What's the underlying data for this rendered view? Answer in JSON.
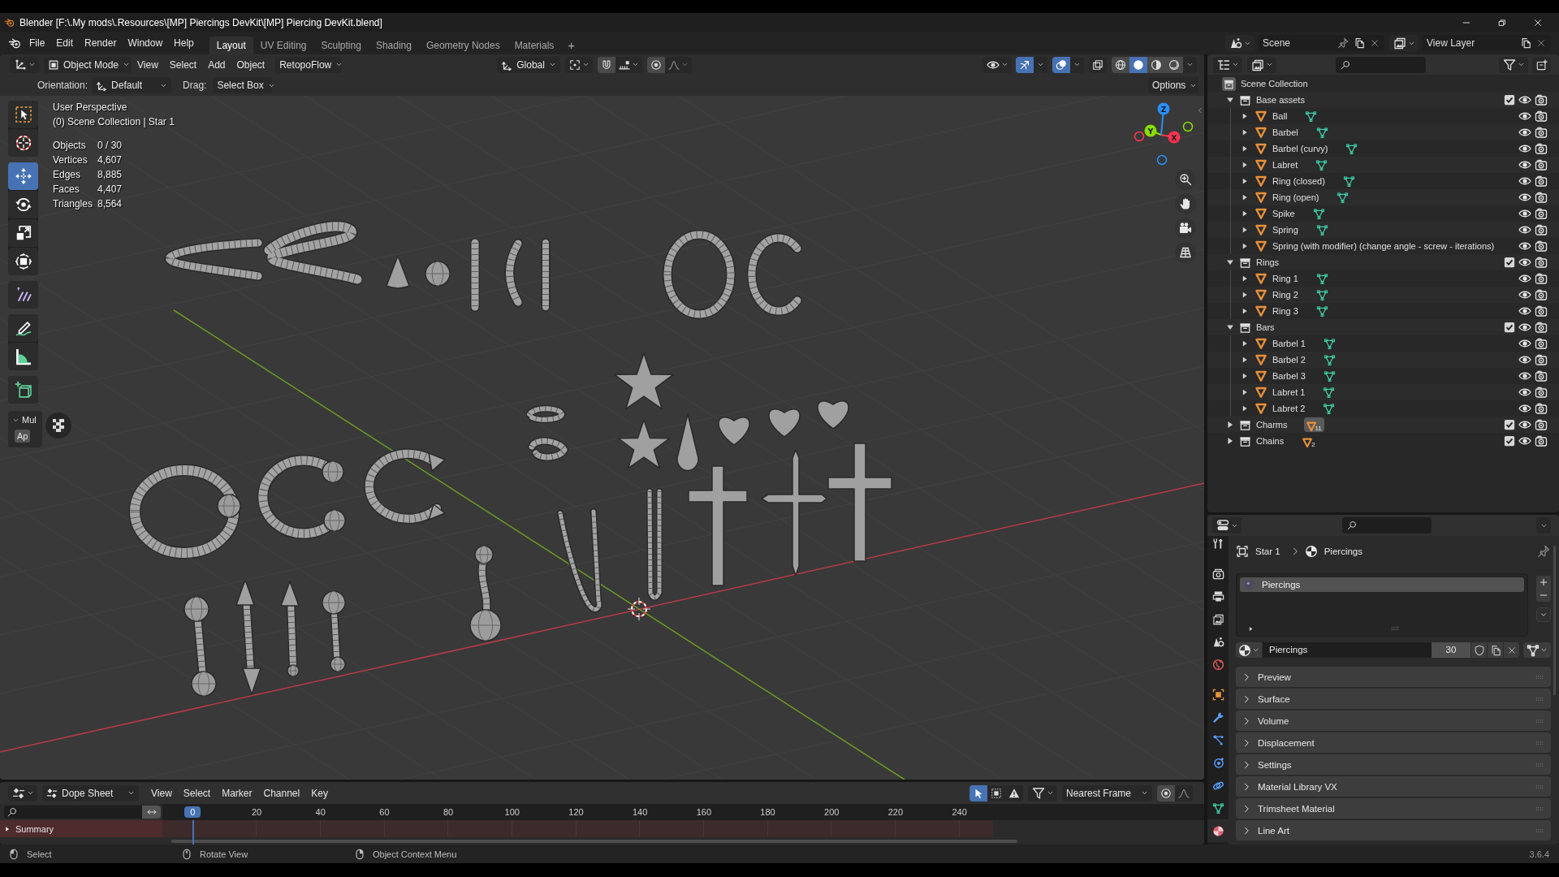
{
  "window": {
    "title": "Blender [F:\\.My mods\\.Resources\\[MP] Piercings DevKit\\[MP] Piercing DevKit.blend]"
  },
  "menus": [
    "File",
    "Edit",
    "Render",
    "Window",
    "Help"
  ],
  "workspaces": [
    {
      "label": "Layout",
      "selected": true
    },
    {
      "label": "UV Editing",
      "selected": false
    },
    {
      "label": "Sculpting",
      "selected": false
    },
    {
      "label": "Shading",
      "selected": false
    },
    {
      "label": "Geometry Nodes",
      "selected": false
    },
    {
      "label": "Materials",
      "selected": false
    }
  ],
  "add_workspace": "+",
  "scene": "Scene",
  "view_layer": "View Layer",
  "viewport": {
    "mode": "Object Mode",
    "menus": [
      "View",
      "Select",
      "Add",
      "Object"
    ],
    "addon_menu": "RetopoFlow",
    "orientation": "Global",
    "gizmos_on": true,
    "overlays_on": true,
    "shading": [
      {
        "kind": "wireframe",
        "selected": false
      },
      {
        "kind": "solid",
        "selected": true
      },
      {
        "kind": "material",
        "selected": false
      },
      {
        "kind": "rendered",
        "selected": false
      }
    ],
    "tool_settings": {
      "orientation_label": "Orientation:",
      "orientation": "Default",
      "drag_label": "Drag:",
      "drag": "Select Box",
      "options": "Options"
    },
    "tools": [
      [
        {
          "kind": "select_box",
          "selected": false
        },
        {
          "kind": "cursor",
          "selected": false
        }
      ],
      [
        {
          "kind": "move",
          "selected": true
        },
        {
          "kind": "rotate",
          "selected": false
        },
        {
          "kind": "scale",
          "selected": false
        },
        {
          "kind": "transform",
          "selected": false
        }
      ],
      [
        {
          "kind": "annotate",
          "selected": false
        }
      ],
      [
        {
          "kind": "draw",
          "selected": false
        },
        {
          "kind": "measure",
          "selected": false
        }
      ],
      [
        {
          "kind": "add_cube",
          "selected": false
        }
      ]
    ],
    "operator_panel": {
      "title": "Mul",
      "button": "Ap",
      "expanded": true
    },
    "info": [
      "User Perspective",
      "(0) Scene Collection | Star 1"
    ],
    "statistics": [
      {
        "label": "Objects",
        "value": "0 / 30"
      },
      {
        "label": "Vertices",
        "value": "4,607"
      },
      {
        "label": "Edges",
        "value": "8,885"
      },
      {
        "label": "Faces",
        "value": "4,407"
      },
      {
        "label": "Triangles",
        "value": "8,564"
      }
    ],
    "gizmo_axes": [
      {
        "label": "X",
        "color": "#ff3352"
      },
      {
        "label": "Y",
        "color": "#8bdc00"
      },
      {
        "label": "Z",
        "color": "#2890ff"
      }
    ]
  },
  "outliner": {
    "root": "Scene Collection",
    "collections": [
      {
        "name": "Base assets",
        "expanded": true,
        "checked": true,
        "visible": true,
        "renderable": true,
        "children": [
          {
            "name": "Ball",
            "expanded": false,
            "data_icon": true,
            "visible": true,
            "renderable": true
          },
          {
            "name": "Barbel",
            "expanded": false,
            "data_icon": true,
            "visible": true,
            "renderable": true
          },
          {
            "name": "Barbel (curvy)",
            "expanded": false,
            "data_icon": true,
            "visible": true,
            "renderable": true
          },
          {
            "name": "Labret",
            "expanded": false,
            "data_icon": true,
            "visible": true,
            "renderable": true
          },
          {
            "name": "Ring (closed)",
            "expanded": false,
            "data_icon": true,
            "visible": true,
            "renderable": true
          },
          {
            "name": "Ring (open)",
            "expanded": false,
            "data_icon": true,
            "visible": true,
            "renderable": true
          },
          {
            "name": "Spike",
            "expanded": false,
            "data_icon": true,
            "visible": true,
            "renderable": true
          },
          {
            "name": "Spring",
            "expanded": false,
            "data_icon": true,
            "visible": true,
            "renderable": true
          },
          {
            "name": "Spring (with modifier) (change angle - screw - iterations)",
            "expanded": false,
            "data_icon": false,
            "visible": true,
            "renderable": true
          }
        ]
      },
      {
        "name": "Rings",
        "expanded": true,
        "checked": true,
        "visible": true,
        "renderable": true,
        "children": [
          {
            "name": "Ring 1",
            "expanded": false,
            "data_icon": true,
            "visible": true,
            "renderable": true
          },
          {
            "name": "Ring 2",
            "expanded": false,
            "data_icon": true,
            "visible": true,
            "renderable": true
          },
          {
            "name": "Ring 3",
            "expanded": false,
            "data_icon": true,
            "visible": true,
            "renderable": true
          }
        ]
      },
      {
        "name": "Bars",
        "expanded": true,
        "checked": true,
        "visible": true,
        "renderable": true,
        "children": [
          {
            "name": "Barbel 1",
            "expanded": false,
            "data_icon": true,
            "visible": true,
            "renderable": true
          },
          {
            "name": "Barbel 2",
            "expanded": false,
            "data_icon": true,
            "visible": true,
            "renderable": true
          },
          {
            "name": "Barbel 3",
            "expanded": false,
            "data_icon": true,
            "visible": true,
            "renderable": true
          },
          {
            "name": "Labret 1",
            "expanded": false,
            "data_icon": true,
            "visible": true,
            "renderable": true
          },
          {
            "name": "Labret 2",
            "expanded": false,
            "data_icon": true,
            "visible": true,
            "renderable": true
          }
        ]
      },
      {
        "name": "Charms",
        "expanded": false,
        "checked": true,
        "visible": true,
        "renderable": true,
        "badge": {
          "count": "11",
          "active": true
        }
      },
      {
        "name": "Chains",
        "expanded": false,
        "checked": true,
        "visible": true,
        "renderable": true,
        "badge": {
          "count": "2",
          "active": false
        }
      }
    ]
  },
  "properties": {
    "tabs": [
      [
        {
          "kind": "tool",
          "selected": false
        }
      ],
      [
        {
          "kind": "render",
          "selected": false
        },
        {
          "kind": "output",
          "selected": false
        },
        {
          "kind": "view_layer",
          "selected": false
        },
        {
          "kind": "scene",
          "selected": false
        },
        {
          "kind": "world",
          "selected": false
        }
      ],
      [
        {
          "kind": "object",
          "selected": false
        },
        {
          "kind": "modifiers",
          "selected": false
        },
        {
          "kind": "particles",
          "selected": false
        },
        {
          "kind": "physics",
          "selected": false
        },
        {
          "kind": "constraints",
          "selected": false
        },
        {
          "kind": "data",
          "selected": false
        },
        {
          "kind": "material",
          "selected": true
        }
      ]
    ],
    "breadcrumb": [
      "Star 1",
      "Piercings"
    ],
    "slots": [
      {
        "name": "Piercings",
        "selected": true
      }
    ],
    "material": "Piercings",
    "users": "30",
    "panels": [
      {
        "title": "Preview",
        "expanded": false
      },
      {
        "title": "Surface",
        "expanded": false
      },
      {
        "title": "Volume",
        "expanded": false
      },
      {
        "title": "Displacement",
        "expanded": false
      },
      {
        "title": "Settings",
        "expanded": false
      },
      {
        "title": "Material Library VX",
        "expanded": false
      },
      {
        "title": "Trimsheet Material",
        "expanded": false
      },
      {
        "title": "Line Art",
        "expanded": false
      }
    ]
  },
  "timeline": {
    "editor": "Dope Sheet",
    "menus": [
      "View",
      "Select",
      "Marker",
      "Channel",
      "Key"
    ],
    "only_selected": true,
    "snapping": "Nearest Frame",
    "current_frame": "0",
    "frame_labels": [
      "20",
      "40",
      "60",
      "80",
      "100",
      "120",
      "140",
      "160",
      "180",
      "200",
      "220",
      "240"
    ],
    "channels": [
      {
        "name": "Summary",
        "expanded": false
      }
    ]
  },
  "status_bar": {
    "hints": [
      {
        "kind": "left",
        "label": "Select"
      },
      {
        "kind": "middle",
        "label": "Rotate View"
      },
      {
        "kind": "right",
        "label": "Object Context Menu"
      }
    ],
    "version": "3.6.4"
  }
}
